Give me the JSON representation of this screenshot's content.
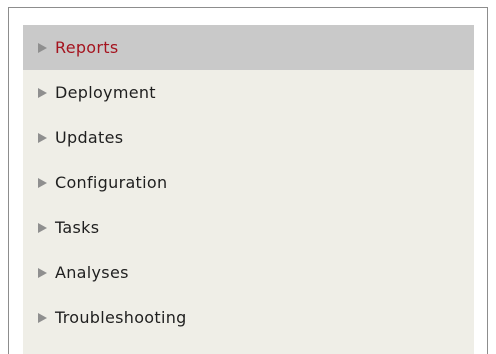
{
  "menu": {
    "items": [
      {
        "label": "Reports",
        "active": true
      },
      {
        "label": "Deployment",
        "active": false
      },
      {
        "label": "Updates",
        "active": false
      },
      {
        "label": "Configuration",
        "active": false
      },
      {
        "label": "Tasks",
        "active": false
      },
      {
        "label": "Analyses",
        "active": false
      },
      {
        "label": "Troubleshooting",
        "active": false
      }
    ]
  },
  "colors": {
    "active_background": "#c9c9c9",
    "active_text": "#a5141f",
    "menu_background": "#efeee7",
    "text": "#1f1f1f",
    "arrow": "#8f8f8f"
  },
  "icons": {
    "arrow": "triangle-right-icon"
  }
}
